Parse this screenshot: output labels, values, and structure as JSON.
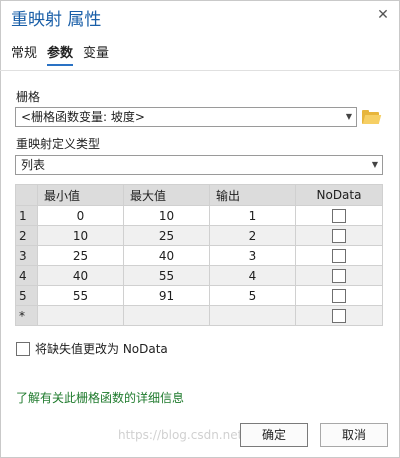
{
  "dialog": {
    "title": "重映射 属性",
    "close_glyph": "✕"
  },
  "tabs": [
    {
      "label": "常规",
      "active": false
    },
    {
      "label": "参数",
      "active": true
    },
    {
      "label": "变量",
      "active": false
    }
  ],
  "raster": {
    "label": "栅格",
    "value": "<栅格函数变量: 坡度>",
    "folder_icon": "folder-open-icon"
  },
  "remap_type": {
    "label": "重映射定义类型",
    "value": "列表"
  },
  "table": {
    "headers": [
      "最小值",
      "最大值",
      "输出",
      "NoData"
    ],
    "rows": [
      {
        "index": "1",
        "min": "0",
        "max": "10",
        "output": "1"
      },
      {
        "index": "2",
        "min": "10",
        "max": "25",
        "output": "2"
      },
      {
        "index": "3",
        "min": "25",
        "max": "40",
        "output": "3"
      },
      {
        "index": "4",
        "min": "40",
        "max": "55",
        "output": "4"
      },
      {
        "index": "5",
        "min": "55",
        "max": "91",
        "output": "5"
      }
    ],
    "new_row_marker": "*"
  },
  "missing_to_nodata": {
    "label": "将缺失值更改为 NoData",
    "checked": false
  },
  "help_link": "了解有关此栅格函数的详细信息",
  "buttons": {
    "ok": "确定",
    "cancel": "取消"
  },
  "watermark": "https://blog.csdn.net/..."
}
